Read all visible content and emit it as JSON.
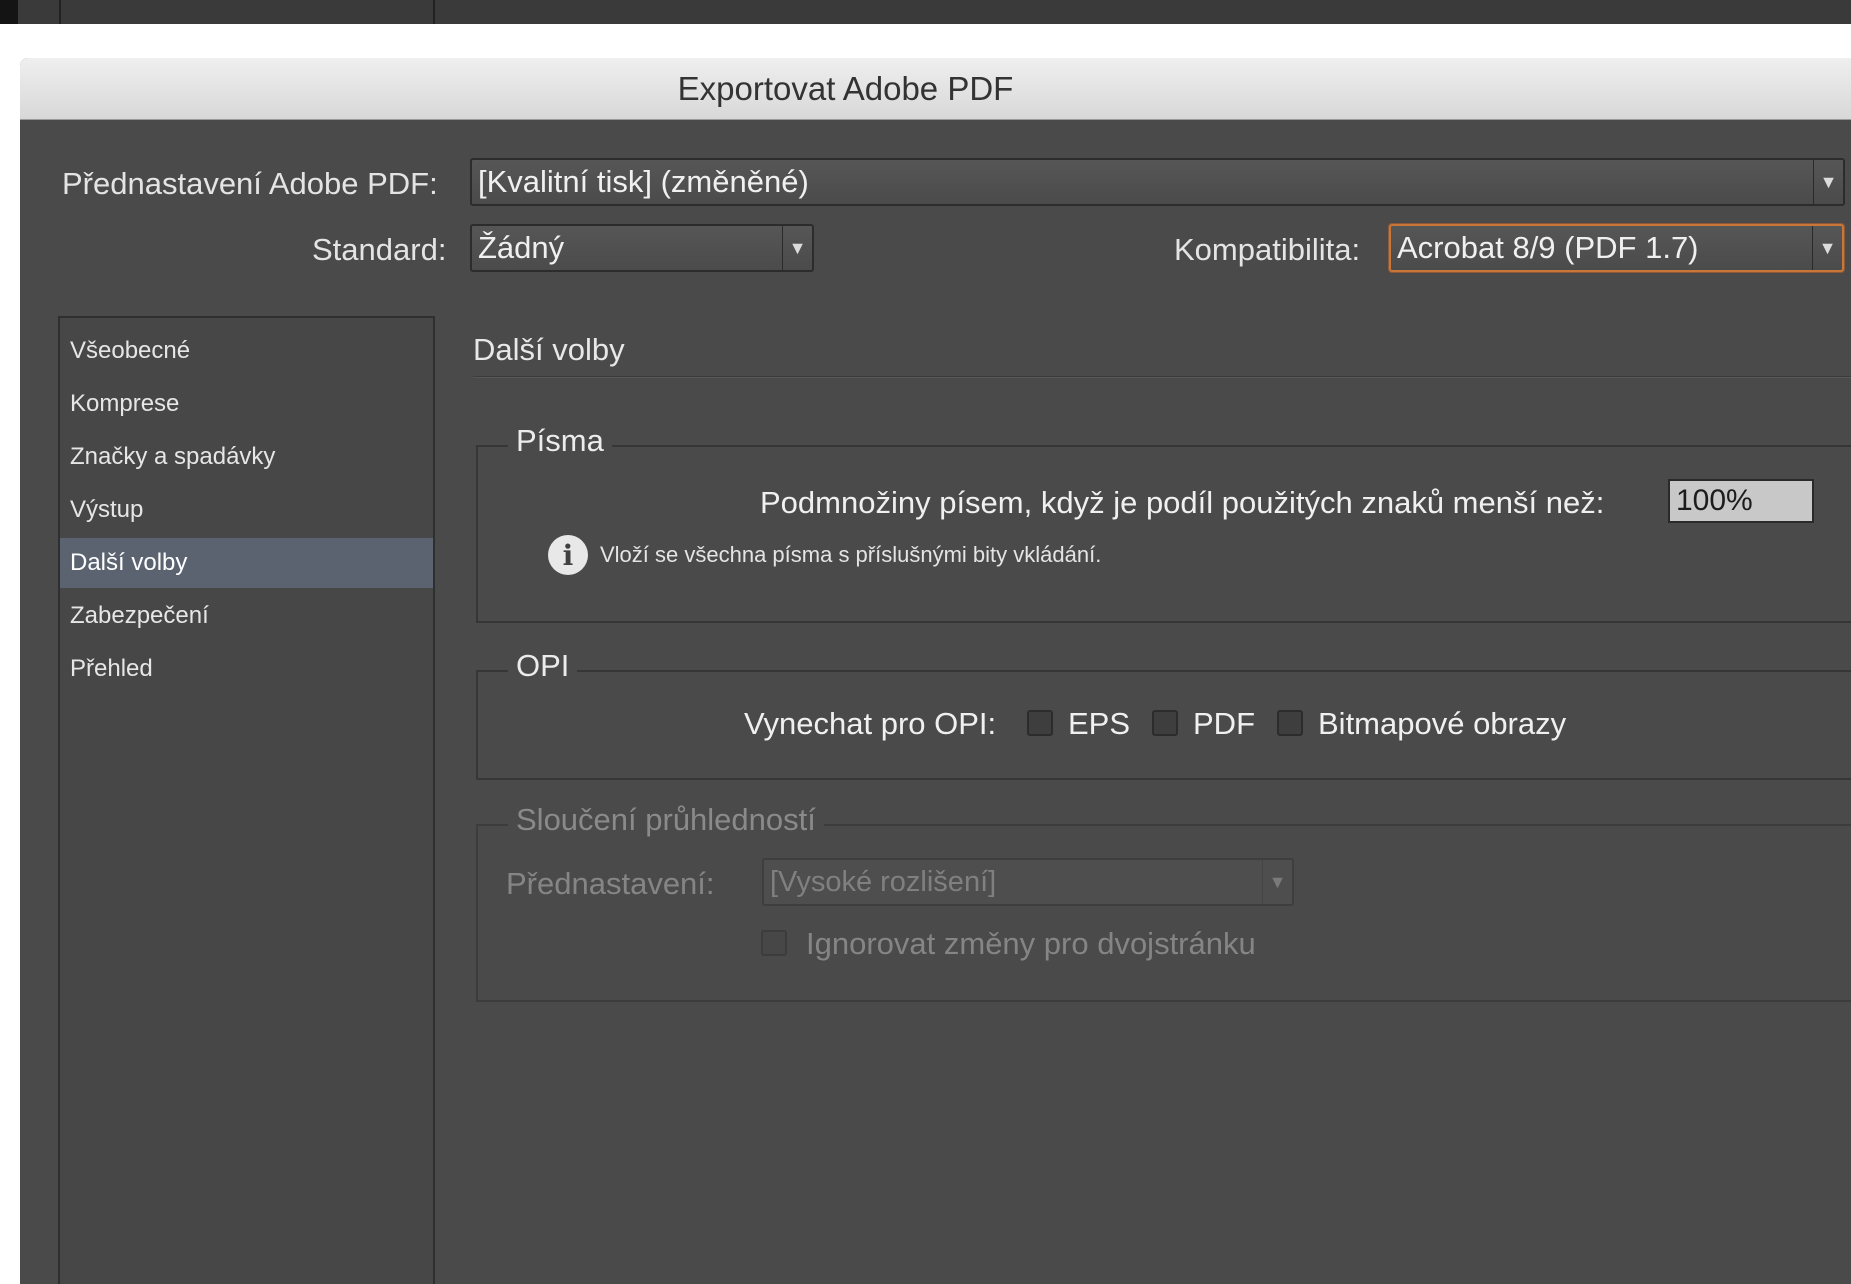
{
  "window": {
    "title": "Exportovat Adobe PDF"
  },
  "top": {
    "preset_label": "Přednastavení Adobe PDF:",
    "preset_value": "[Kvalitní tisk] (změněné)",
    "standard_label": "Standard:",
    "standard_value": "Žádný",
    "compat_label": "Kompatibilita:",
    "compat_value": "Acrobat 8/9 (PDF 1.7)"
  },
  "nav": {
    "items": [
      {
        "label": "Všeobecné"
      },
      {
        "label": "Komprese"
      },
      {
        "label": "Značky a spadávky"
      },
      {
        "label": "Výstup"
      },
      {
        "label": "Další volby"
      },
      {
        "label": "Zabezpečení"
      },
      {
        "label": "Přehled"
      }
    ],
    "selected": "Další volby"
  },
  "content": {
    "title": "Další volby",
    "fonts": {
      "legend": "Písma",
      "subset_label": "Podmnožiny písem, když je podíl použitých znaků menší než:",
      "subset_value": "100%",
      "info": "Vloží se všechna písma s příslušnými bity vkládání."
    },
    "opi": {
      "legend": "OPI",
      "omit_label": "Vynechat pro OPI:",
      "eps_label": "EPS",
      "eps_checked": false,
      "pdf_label": "PDF",
      "pdf_checked": false,
      "bitmap_label": "Bitmapové obrazy",
      "bitmap_checked": false
    },
    "flattener": {
      "legend": "Sloučení průhledností",
      "preset_label": "Přednastavení:",
      "preset_value": "[Vysoké rozlišení]",
      "ignore_label": "Ignorovat změny pro dvojstránku",
      "ignore_checked": false,
      "disabled": true
    }
  },
  "colors": {
    "dialog_bg": "#4a4a4a",
    "focus_ring": "#c9763a",
    "nav_selected": "#5b6371"
  }
}
